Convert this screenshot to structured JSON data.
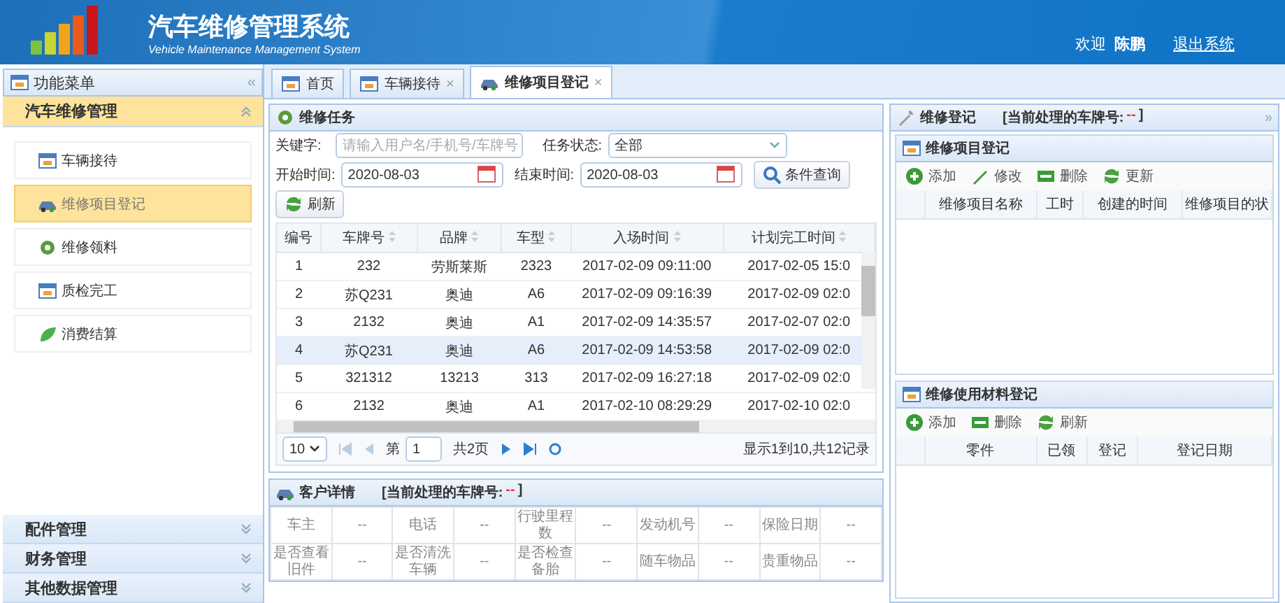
{
  "header": {
    "title": "汽车维修管理系统",
    "subtitle": "Vehicle Maintenance Management System",
    "welcome": "欢迎",
    "user": "陈鹏",
    "logout": "退出系统"
  },
  "sidebar": {
    "title": "功能菜单",
    "collapse": "«",
    "groups": [
      {
        "label": "汽车维修管理",
        "expanded": true,
        "items": [
          {
            "label": "车辆接待",
            "selected": false
          },
          {
            "label": "维修项目登记",
            "selected": true
          },
          {
            "label": "维修领料",
            "selected": false
          },
          {
            "label": "质检完工",
            "selected": false
          },
          {
            "label": "消费结算",
            "selected": false
          }
        ]
      },
      {
        "label": "配件管理",
        "expanded": false
      },
      {
        "label": "财务管理",
        "expanded": false
      },
      {
        "label": "其他数据管理",
        "expanded": false
      }
    ]
  },
  "tabs": [
    {
      "label": "首页",
      "closable": false,
      "selected": false
    },
    {
      "label": "车辆接待",
      "closable": true,
      "selected": false
    },
    {
      "label": "维修项目登记",
      "closable": true,
      "selected": true
    }
  ],
  "close_mark": "×",
  "task_panel": {
    "title": "维修任务",
    "keyword_label": "关键字:",
    "keyword_placeholder": "请输入用户名/手机号/车牌号",
    "status_label": "任务状态:",
    "status_value": "全部",
    "start_label": "开始时间:",
    "start_value": "2020-08-03",
    "end_label": "结束时间:",
    "end_value": "2020-08-03",
    "search_button": "条件查询",
    "refresh_button": "刷新",
    "table": {
      "columns": [
        {
          "label": "编号",
          "sortable": false
        },
        {
          "label": "车牌号",
          "sortable": true
        },
        {
          "label": "品牌",
          "sortable": true
        },
        {
          "label": "车型",
          "sortable": true
        },
        {
          "label": "入场时间",
          "sortable": true
        },
        {
          "label": "计划完工时间",
          "sortable": true
        }
      ],
      "rows": [
        {
          "cells": [
            "1",
            "232",
            "劳斯莱斯",
            "2323",
            "2017-02-09 09:11:00",
            "2017-02-05 15:0"
          ],
          "selected": false
        },
        {
          "cells": [
            "2",
            "苏Q231",
            "奥迪",
            "A6",
            "2017-02-09 09:16:39",
            "2017-02-09 02:0"
          ],
          "selected": false
        },
        {
          "cells": [
            "3",
            "2132",
            "奥迪",
            "A1",
            "2017-02-09 14:35:57",
            "2017-02-07 02:0"
          ],
          "selected": false
        },
        {
          "cells": [
            "4",
            "苏Q231",
            "奥迪",
            "A6",
            "2017-02-09 14:53:58",
            "2017-02-09 02:0"
          ],
          "selected": true
        },
        {
          "cells": [
            "5",
            "321312",
            "13213",
            "313",
            "2017-02-09 16:27:18",
            "2017-02-09 02:0"
          ],
          "selected": false
        },
        {
          "cells": [
            "6",
            "2132",
            "奥迪",
            "A1",
            "2017-02-10 08:29:29",
            "2017-02-10 02:0"
          ],
          "selected": false
        }
      ]
    },
    "pager": {
      "page_size": "10",
      "page_label": "第",
      "page_value": "1",
      "total_pages": "共2页",
      "summary": "显示1到10,共12记录"
    }
  },
  "customer_panel": {
    "title": "客户详情",
    "plate_prefix": "[当前处理的车牌号:",
    "plate_value": "--",
    "plate_suffix": "]",
    "rows": [
      [
        "车主",
        "--",
        "电话",
        "--",
        "行驶里程数",
        "--",
        "发动机号",
        "--",
        "保险日期",
        "--"
      ],
      [
        "是否查看旧件",
        "--",
        "是否清洗车辆",
        "--",
        "是否检查备胎",
        "--",
        "随车物品",
        "--",
        "贵重物品",
        "--"
      ]
    ]
  },
  "register_panel": {
    "title": "维修登记",
    "plate_prefix": "[当前处理的车牌号:",
    "plate_value": "--",
    "plate_suffix": "]",
    "expand": "»",
    "items_section": {
      "title": "维修项目登记",
      "toolbar": [
        {
          "kind": "add",
          "label": "添加"
        },
        {
          "kind": "edit",
          "label": "修改"
        },
        {
          "kind": "delete",
          "label": "删除"
        },
        {
          "kind": "refresh",
          "label": "更新"
        }
      ],
      "columns": [
        "维修项目名称",
        "工时",
        "创建的时间",
        "维修项目的状"
      ]
    },
    "materials_section": {
      "title": "维修使用材料登记",
      "toolbar": [
        {
          "kind": "add",
          "label": "添加"
        },
        {
          "kind": "delete",
          "label": "删除"
        },
        {
          "kind": "refresh",
          "label": "刷新"
        }
      ],
      "columns": [
        "零件",
        "已领",
        "登记",
        "登记日期"
      ]
    }
  }
}
